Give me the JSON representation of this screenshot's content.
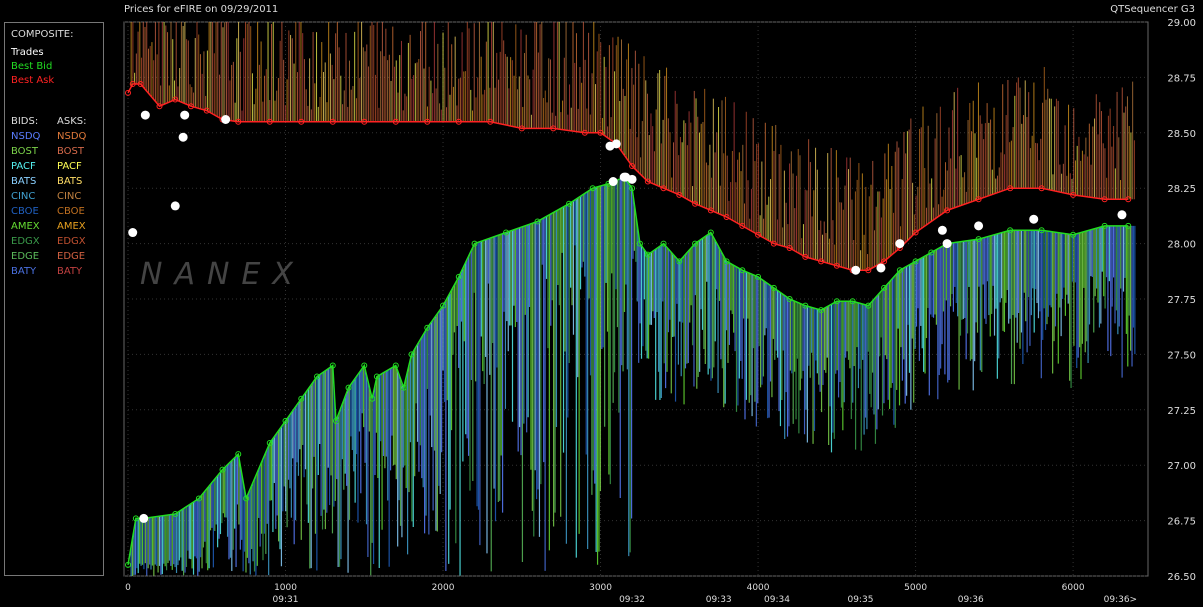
{
  "header": {
    "title_left": "Prices for  eFIRE  on  09/29/2011",
    "title_right": "QTSequencer G3"
  },
  "watermark": "NANEX",
  "legend": {
    "composite_label": "COMPOSITE:",
    "composite": [
      {
        "label": "Trades",
        "color": "#ffffff"
      },
      {
        "label": "Best Bid",
        "color": "#22dd22"
      },
      {
        "label": "Best Ask",
        "color": "#ff2222"
      }
    ],
    "bids_label": "BIDS:",
    "asks_label": "ASKS:",
    "exchanges": [
      {
        "bid": "NSDQ",
        "bid_color": "#5a7dff",
        "ask": "NSDQ",
        "ask_color": "#e07a3a"
      },
      {
        "bid": "BOST",
        "bid_color": "#7bd24a",
        "ask": "BOST",
        "ask_color": "#d4694a"
      },
      {
        "bid": "PACF",
        "bid_color": "#55f0f0",
        "ask": "PACF",
        "ask_color": "#ffff55"
      },
      {
        "bid": "BATS",
        "bid_color": "#8ad0ff",
        "ask": "BATS",
        "ask_color": "#ffdd66"
      },
      {
        "bid": "CINC",
        "bid_color": "#40a0d0",
        "ask": "CINC",
        "ask_color": "#c08040"
      },
      {
        "bid": "CBOE",
        "bid_color": "#2060c0",
        "ask": "CBOE",
        "ask_color": "#c07020"
      },
      {
        "bid": "AMEX",
        "bid_color": "#66dd33",
        "ask": "AMEX",
        "ask_color": "#e6a020"
      },
      {
        "bid": "EDGX",
        "bid_color": "#3a9a4a",
        "ask": "EDGX",
        "ask_color": "#c05030"
      },
      {
        "bid": "EDGE",
        "bid_color": "#5aba5a",
        "ask": "EDGE",
        "ask_color": "#d06040"
      },
      {
        "bid": "BATY",
        "bid_color": "#4a70e0",
        "ask": "BATY",
        "ask_color": "#c04040"
      }
    ]
  },
  "chart_data": {
    "type": "line",
    "title": "Prices for  eFIRE  on  09/29/2011",
    "xlim": [
      0,
      6450
    ],
    "ylim": [
      26.5,
      29.0
    ],
    "x_ticks": [
      0,
      1000,
      2000,
      3000,
      4000,
      5000,
      6000
    ],
    "y_ticks": [
      "26.50",
      "26.75",
      "27.00",
      "27.25",
      "27.50",
      "27.75",
      "28.00",
      "28.25",
      "28.50",
      "28.75",
      "29.00"
    ],
    "time_labels": [
      {
        "x": 1000,
        "label": "09:31"
      },
      {
        "x": 3200,
        "label": "09:32"
      },
      {
        "x": 3750,
        "label": "09:33"
      },
      {
        "x": 4120,
        "label": "09:34"
      },
      {
        "x": 4650,
        "label": "09:35"
      },
      {
        "x": 5350,
        "label": "09:36"
      },
      {
        "x": 6300,
        "label": "09:36>"
      }
    ],
    "series": [
      {
        "name": "Best Bid",
        "color": "#22dd22",
        "x": [
          0,
          50,
          100,
          300,
          450,
          600,
          700,
          750,
          900,
          1000,
          1100,
          1200,
          1300,
          1320,
          1400,
          1500,
          1550,
          1580,
          1700,
          1750,
          1800,
          1900,
          2000,
          2100,
          2200,
          2400,
          2600,
          2800,
          2950,
          3050,
          3150,
          3200,
          3250,
          3300,
          3400,
          3500,
          3600,
          3700,
          3800,
          3900,
          4000,
          4100,
          4200,
          4300,
          4400,
          4500,
          4600,
          4700,
          4800,
          4900,
          5000,
          5100,
          5200,
          5400,
          5600,
          5800,
          6000,
          6200,
          6350
        ],
        "y": [
          26.55,
          26.76,
          26.76,
          26.78,
          26.85,
          26.98,
          27.05,
          26.85,
          27.1,
          27.2,
          27.3,
          27.4,
          27.45,
          27.2,
          27.35,
          27.45,
          27.3,
          27.4,
          27.45,
          27.35,
          27.5,
          27.62,
          27.72,
          27.85,
          28.0,
          28.05,
          28.1,
          28.18,
          28.25,
          28.27,
          28.3,
          28.25,
          28.0,
          27.95,
          28.0,
          27.92,
          28.0,
          28.05,
          27.92,
          27.88,
          27.85,
          27.8,
          27.75,
          27.72,
          27.7,
          27.74,
          27.74,
          27.72,
          27.8,
          27.88,
          27.92,
          27.96,
          28.0,
          28.02,
          28.06,
          28.06,
          28.04,
          28.08,
          28.08
        ]
      },
      {
        "name": "Best Ask",
        "color": "#ff2222",
        "x": [
          0,
          30,
          80,
          200,
          300,
          400,
          500,
          600,
          700,
          900,
          1100,
          1300,
          1500,
          1700,
          1900,
          2100,
          2300,
          2500,
          2700,
          2900,
          3000,
          3100,
          3200,
          3300,
          3400,
          3500,
          3600,
          3700,
          3800,
          3900,
          4000,
          4100,
          4200,
          4300,
          4400,
          4500,
          4600,
          4700,
          4800,
          4900,
          5000,
          5200,
          5400,
          5600,
          5800,
          6000,
          6200,
          6350
        ],
        "y": [
          28.68,
          28.72,
          28.72,
          28.62,
          28.65,
          28.62,
          28.6,
          28.56,
          28.55,
          28.55,
          28.55,
          28.55,
          28.55,
          28.55,
          28.55,
          28.55,
          28.55,
          28.52,
          28.52,
          28.5,
          28.5,
          28.45,
          28.35,
          28.28,
          28.25,
          28.22,
          28.18,
          28.15,
          28.12,
          28.08,
          28.04,
          28.0,
          27.98,
          27.94,
          27.92,
          27.9,
          27.88,
          27.88,
          27.92,
          27.98,
          28.05,
          28.15,
          28.2,
          28.25,
          28.25,
          28.22,
          28.2,
          28.2
        ]
      },
      {
        "name": "Trades",
        "color": "#ffffff",
        "type": "scatter",
        "x": [
          30,
          110,
          300,
          350,
          360,
          620,
          3060,
          3080,
          3150,
          3160,
          3200,
          4620,
          4780,
          4900,
          5170,
          5200,
          5400,
          5750,
          6310,
          100,
          3100
        ],
        "y": [
          28.05,
          28.58,
          28.17,
          28.48,
          28.58,
          28.56,
          28.44,
          28.28,
          28.3,
          28.3,
          28.29,
          27.88,
          27.89,
          28.0,
          28.06,
          28.0,
          28.08,
          28.11,
          28.13,
          26.76,
          28.45
        ]
      }
    ]
  }
}
